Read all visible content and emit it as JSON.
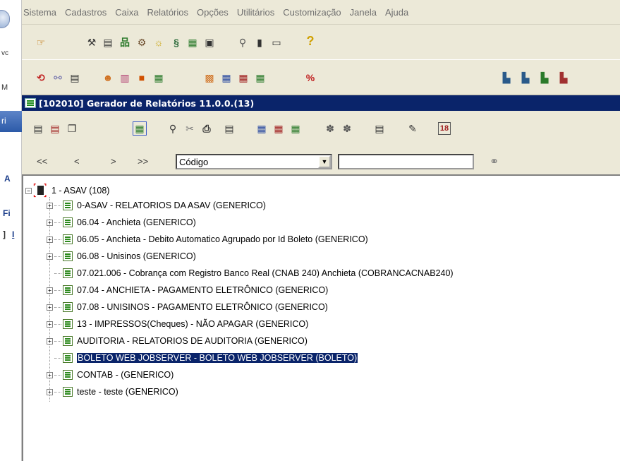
{
  "left_strip": {
    "glyphs": [
      "vc",
      "M",
      "ri",
      "A",
      "Fi",
      "]",
      "I"
    ]
  },
  "menubar": {
    "items": [
      "Sistema",
      "Cadastros",
      "Caixa",
      "Relatórios",
      "Opções",
      "Utilitários",
      "Customização",
      "Janela",
      "Ajuda"
    ]
  },
  "window": {
    "title": "[102010] Gerador de Relatórios 11.0.0.(13)"
  },
  "nav": {
    "first": "<<",
    "prev": "<",
    "next": ">",
    "last": ">>",
    "field_select": "Código",
    "search_value": ""
  },
  "tree": {
    "root": "1 - ASAV (108)",
    "items": [
      {
        "label": "0-ASAV - RELATORIOS DA ASAV (GENERICO)",
        "expandable": true
      },
      {
        "label": "06.04 - Anchieta (GENERICO)",
        "expandable": true
      },
      {
        "label": "06.05 - Anchieta - Debito Automatico Agrupado por Id Boleto (GENERICO)",
        "expandable": true
      },
      {
        "label": "06.08 - Unisinos (GENERICO)",
        "expandable": true
      },
      {
        "label": "07.021.006 - Cobrança com Registro Banco Real (CNAB 240) Anchieta (COBRANCACNAB240)",
        "expandable": false
      },
      {
        "label": "07.04 - ANCHIETA - PAGAMENTO ELETRÔNICO (GENERICO)",
        "expandable": true
      },
      {
        "label": "07.08 - UNISINOS - PAGAMENTO ELETRÔNICO (GENERICO)",
        "expandable": true
      },
      {
        "label": "13 - IMPRESSOS(Cheques) - NÃO APAGAR (GENERICO)",
        "expandable": true
      },
      {
        "label": "AUDITORIA - RELATORIOS DE AUDITORIA (GENERICO)",
        "expandable": true
      },
      {
        "label": "BOLETO WEB JOBSERVER - BOLETO WEB JOBSERVER (BOLETO)",
        "expandable": false,
        "selected": true
      },
      {
        "label": "CONTAB -  (GENERICO)",
        "expandable": true
      },
      {
        "label": "teste - teste (GENERICO)",
        "expandable": true
      }
    ]
  },
  "colors": {
    "titlebar": "#0a246a",
    "toolbar": "#ece9d8",
    "selection": "#0a246a"
  }
}
